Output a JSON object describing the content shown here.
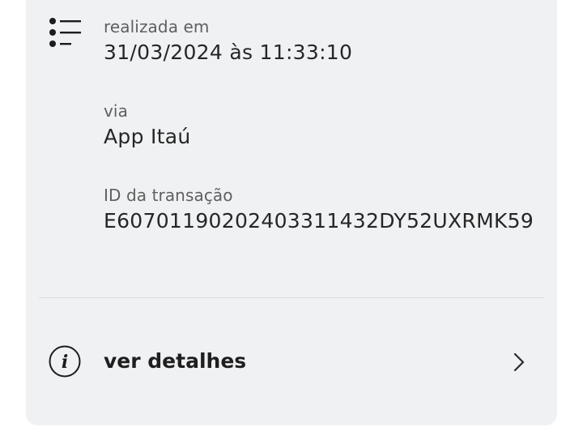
{
  "transaction": {
    "date_label": "realizada em",
    "date_value": "31/03/2024 às 11:33:10",
    "channel_label": "via",
    "channel_value": "App Itaú",
    "id_label": "ID da transação",
    "id_value": "E60701190202403311432DY52UXRMK59"
  },
  "details": {
    "label": "ver detalhes"
  },
  "icons": {
    "list": "list-icon",
    "info": "info-icon",
    "chevron": "chevron-right-icon"
  },
  "colors": {
    "card_background": "#f0f1f3",
    "text_primary": "#262626",
    "text_secondary": "#5f5f5f"
  }
}
